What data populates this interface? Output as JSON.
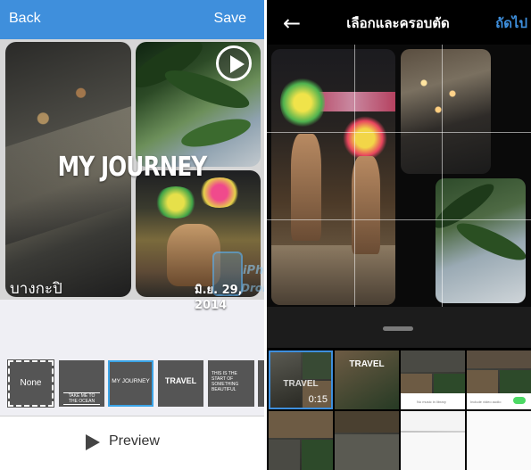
{
  "left_panel": {
    "header": {
      "back_label": "Back",
      "save_label": "Save"
    },
    "collage": {
      "title": "MY JOURNEY",
      "location": "บางกะปิ",
      "date": "มิ.ย. 29, 2014",
      "watermark_line1": "iPhone",
      "watermark_line2": "Droid"
    },
    "title_styles": [
      {
        "label": "None"
      },
      {
        "label": "TAKE ME TO THE OCEAN"
      },
      {
        "label": "MY JOURNEY",
        "selected": true
      },
      {
        "label": "TRAVEL"
      },
      {
        "label": "THIS IS THE START OF SOMETHING BEAUTIFUL"
      }
    ],
    "preview_label": "Preview"
  },
  "right_panel": {
    "header": {
      "back_icon": "arrow-left-icon",
      "title": "เลือกและครอบตัด",
      "next_label": "ถัดไป"
    },
    "layouts": {
      "selected_title": "TRAVEL",
      "selected_duration": "0:15",
      "second_title": "TRAVEL",
      "music_label": "No music in library",
      "toggle_label": "Include video audio"
    }
  },
  "colors": {
    "accent": "#3e8fdd",
    "header_blue": "#3f8fdc",
    "selection_border": "#3aa3e6"
  }
}
